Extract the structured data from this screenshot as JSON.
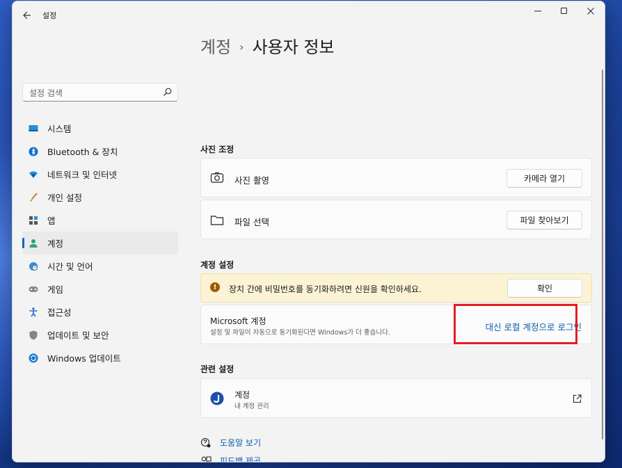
{
  "window": {
    "title": "설정"
  },
  "search": {
    "placeholder": "설정 검색"
  },
  "sidebar": {
    "items": [
      {
        "label": "시스템",
        "icon": "monitor-icon"
      },
      {
        "label": "Bluetooth & 장치",
        "icon": "bluetooth-icon"
      },
      {
        "label": "네트워크 및 인터넷",
        "icon": "wifi-icon"
      },
      {
        "label": "개인 설정",
        "icon": "brush-icon"
      },
      {
        "label": "앱",
        "icon": "apps-icon"
      },
      {
        "label": "계정",
        "icon": "person-icon",
        "active": true
      },
      {
        "label": "시간 및 언어",
        "icon": "globe-clock-icon"
      },
      {
        "label": "게임",
        "icon": "gamepad-icon"
      },
      {
        "label": "접근성",
        "icon": "accessibility-icon"
      },
      {
        "label": "업데이트 및 보안",
        "icon": "shield-icon"
      },
      {
        "label": "Windows 업데이트",
        "icon": "windows-update-icon"
      }
    ]
  },
  "breadcrumb": {
    "parent": "계정",
    "current": "사용자 정보"
  },
  "photo_section": {
    "title": "사진 조정",
    "take_photo": {
      "label": "사진 촬영",
      "button": "카메라 열기"
    },
    "choose_file": {
      "label": "파일 선택",
      "button": "파일 찾아보기"
    }
  },
  "account_section": {
    "title": "계정 설정",
    "warning": {
      "text": "장치 간에 비밀번호를 동기화하려면 신원을 확인하세요.",
      "button": "확인"
    },
    "microsoft": {
      "title": "Microsoft 계정",
      "description": "설정 및 파일이 자동으로 동기화된다면 Windows가 더 좋습니다.",
      "link": "대신 로컬 계정으로 로그인"
    }
  },
  "related_section": {
    "title": "관련 설정",
    "accounts": {
      "title": "계정",
      "subtitle": "내 계정 관리"
    }
  },
  "footer": {
    "help": "도움말 보기",
    "feedback": "피드백 제공"
  },
  "colors": {
    "accent": "#0067c0",
    "highlight": "#e51c23",
    "warning_bg": "#fcf3d4"
  }
}
